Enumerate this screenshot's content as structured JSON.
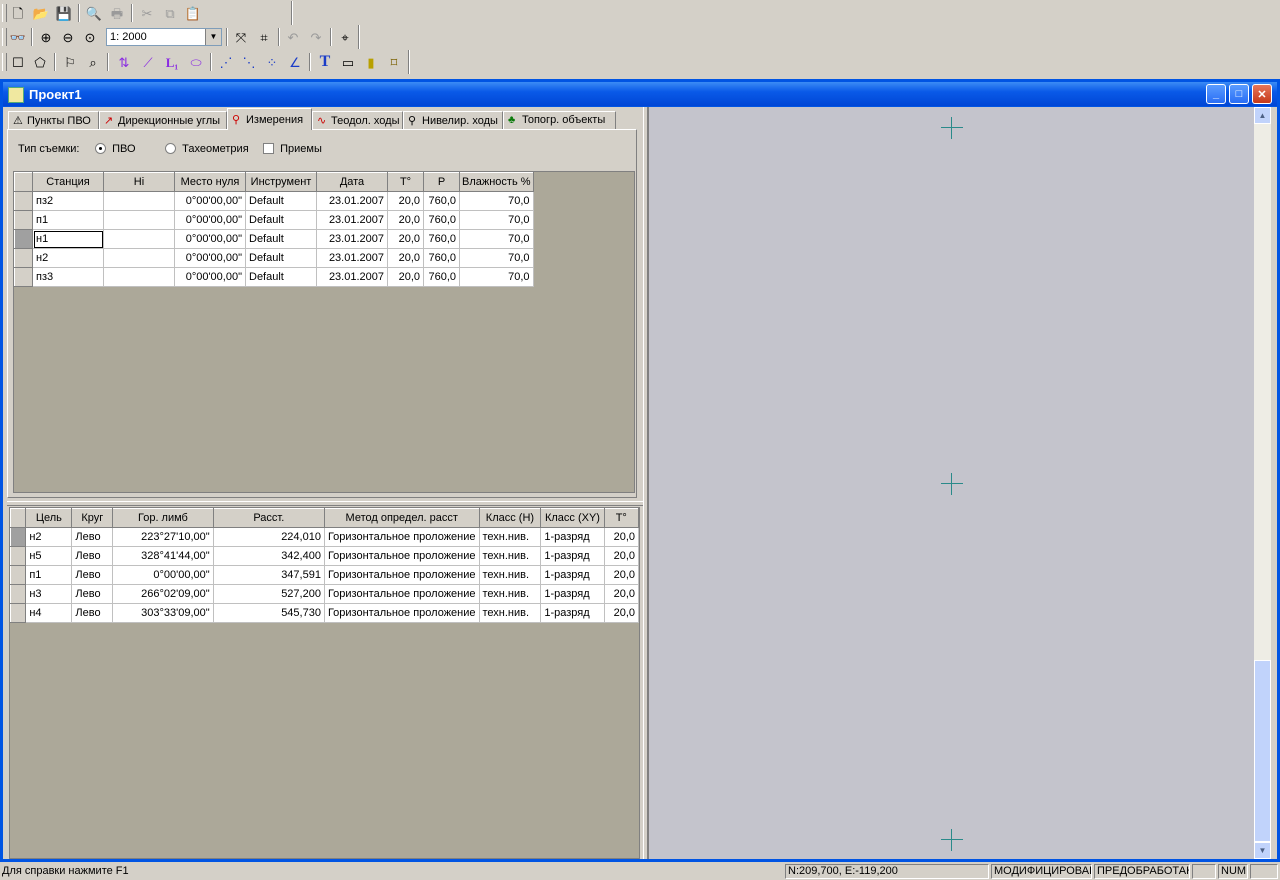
{
  "toolbar": {
    "scale_value": "1: 2000",
    "text_tool_label": "T"
  },
  "window": {
    "title": "Проект1"
  },
  "tabs": [
    {
      "label": "Пункты ПВО",
      "icon": "points-icon"
    },
    {
      "label": "Дирекционные углы",
      "icon": "angles-icon"
    },
    {
      "label": "Измерения",
      "icon": "measure-icon"
    },
    {
      "label": "Теодол. ходы",
      "icon": "theodolite-icon"
    },
    {
      "label": "Нивелир. ходы",
      "icon": "level-icon"
    },
    {
      "label": "Топогр. объекты",
      "icon": "tree-icon"
    }
  ],
  "survey": {
    "label": "Тип съемки:",
    "options": [
      {
        "label": "ПВО",
        "selected": true
      },
      {
        "label": "Тахеометрия",
        "selected": false
      }
    ],
    "checkbox": {
      "label": "Приемы",
      "checked": false
    }
  },
  "stations": {
    "columns": [
      "Станция",
      "Hi",
      "Место нуля",
      "Инструмент",
      "Дата",
      "T°",
      "P",
      "Влажность %"
    ],
    "rows": [
      [
        "пз2",
        "",
        "0°00'00,00\"",
        "Default",
        "23.01.2007",
        "20,0",
        "760,0",
        "70,0"
      ],
      [
        "п1",
        "",
        "0°00'00,00\"",
        "Default",
        "23.01.2007",
        "20,0",
        "760,0",
        "70,0"
      ],
      [
        "н1",
        "",
        "0°00'00,00\"",
        "Default",
        "23.01.2007",
        "20,0",
        "760,0",
        "70,0"
      ],
      [
        "н2",
        "",
        "0°00'00,00\"",
        "Default",
        "23.01.2007",
        "20,0",
        "760,0",
        "70,0"
      ],
      [
        "пз3",
        "",
        "0°00'00,00\"",
        "Default",
        "23.01.2007",
        "20,0",
        "760,0",
        "70,0"
      ]
    ]
  },
  "measurements": {
    "columns": [
      "Цель",
      "Круг",
      "Гор. лимб",
      "Расст.",
      "Метод определ. расст",
      "Класс (H)",
      "Класс (XY)",
      "T°"
    ],
    "rows": [
      [
        "н2",
        "Лево",
        "223°27'10,00\"",
        "224,010",
        "Горизонтальное проложение",
        "техн.нив.",
        "1-разряд",
        "20,0"
      ],
      [
        "н5",
        "Лево",
        "328°41'44,00\"",
        "342,400",
        "Горизонтальное проложение",
        "техн.нив.",
        "1-разряд",
        "20,0"
      ],
      [
        "п1",
        "Лево",
        "0°00'00,00\"",
        "347,591",
        "Горизонтальное проложение",
        "техн.нив.",
        "1-разряд",
        "20,0"
      ],
      [
        "н3",
        "Лево",
        "266°02'09,00\"",
        "527,200",
        "Горизонтальное проложение",
        "техн.нив.",
        "1-разряд",
        "20,0"
      ],
      [
        "н4",
        "Лево",
        "303°33'09,00\"",
        "545,730",
        "Горизонтальное проложение",
        "техн.нив.",
        "1-разряд",
        "20,0"
      ]
    ]
  },
  "status": {
    "help": "Для справки  нажмите  F1",
    "coords": "N:209,700, E:-119,200",
    "modified": "МОДИФИЦИРОВАН",
    "preprocessed": "ПРЕДОБРАБОТАН",
    "num": "NUM"
  },
  "colors": {
    "title_bar": "#0054e3",
    "map_bg": "#c4c4cc",
    "crosshair": "#2a8a8a"
  }
}
